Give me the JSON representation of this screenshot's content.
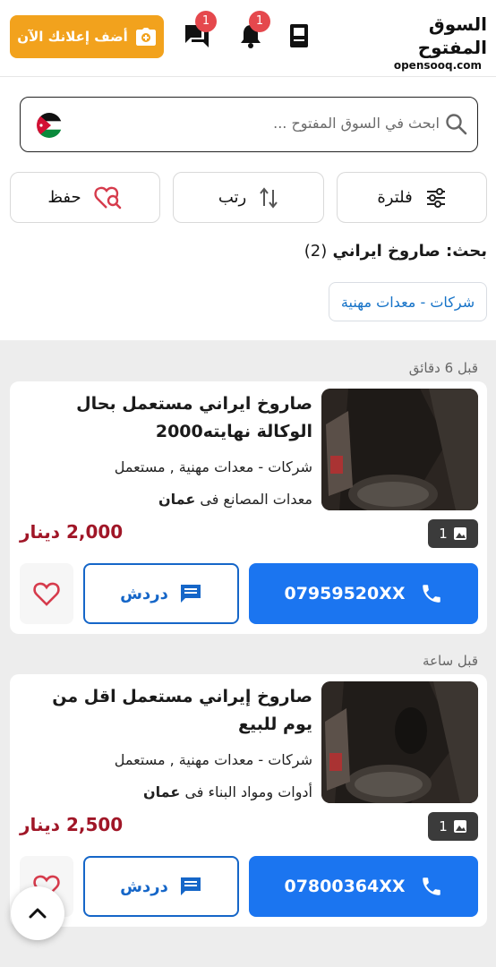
{
  "header": {
    "logo_ar": "السوق المفتوح",
    "logo_en": "opensooq.com",
    "add_ad_label": "أضف إعلانك الآن",
    "chat_badge": "1",
    "notif_badge": "1"
  },
  "search": {
    "placeholder": "ابحث في السوق المفتوح ..."
  },
  "toolbar": {
    "filter_label": "فلترة",
    "sort_label": "رتب",
    "save_label": "حفظ"
  },
  "results": {
    "title": "بحث: صاروخ ايراني",
    "count": "(2)",
    "chip": "شركات - معدات مهنية"
  },
  "listings": [
    {
      "time": "قبل 6 دقائق",
      "title": "صاروخ ايراني مستعمل بحال الوكالة نهايته2000",
      "category": "شركات - معدات مهنية , مستعمل",
      "location_prefix": "معدات المصانع فى",
      "city": "عمان",
      "price": "2,000 دينار",
      "image_count": "1",
      "phone": "07959520XX",
      "chat_label": "دردش"
    },
    {
      "time": "قبل ساعة",
      "title": "صاروخ إيراني مستعمل اقل من يوم للبيع",
      "category": "شركات - معدات مهنية , مستعمل",
      "location_prefix": "أدوات ومواد البناء فى",
      "city": "عمان",
      "price": "2,500 دينار",
      "image_count": "1",
      "phone": "07800364XX",
      "chat_label": "دردش"
    }
  ],
  "colors": {
    "accent_orange": "#f2a21d",
    "call_blue": "#1b75f0",
    "price_red": "#a01627",
    "chip_blue": "#1673c8",
    "badge_red": "#e5484d"
  }
}
